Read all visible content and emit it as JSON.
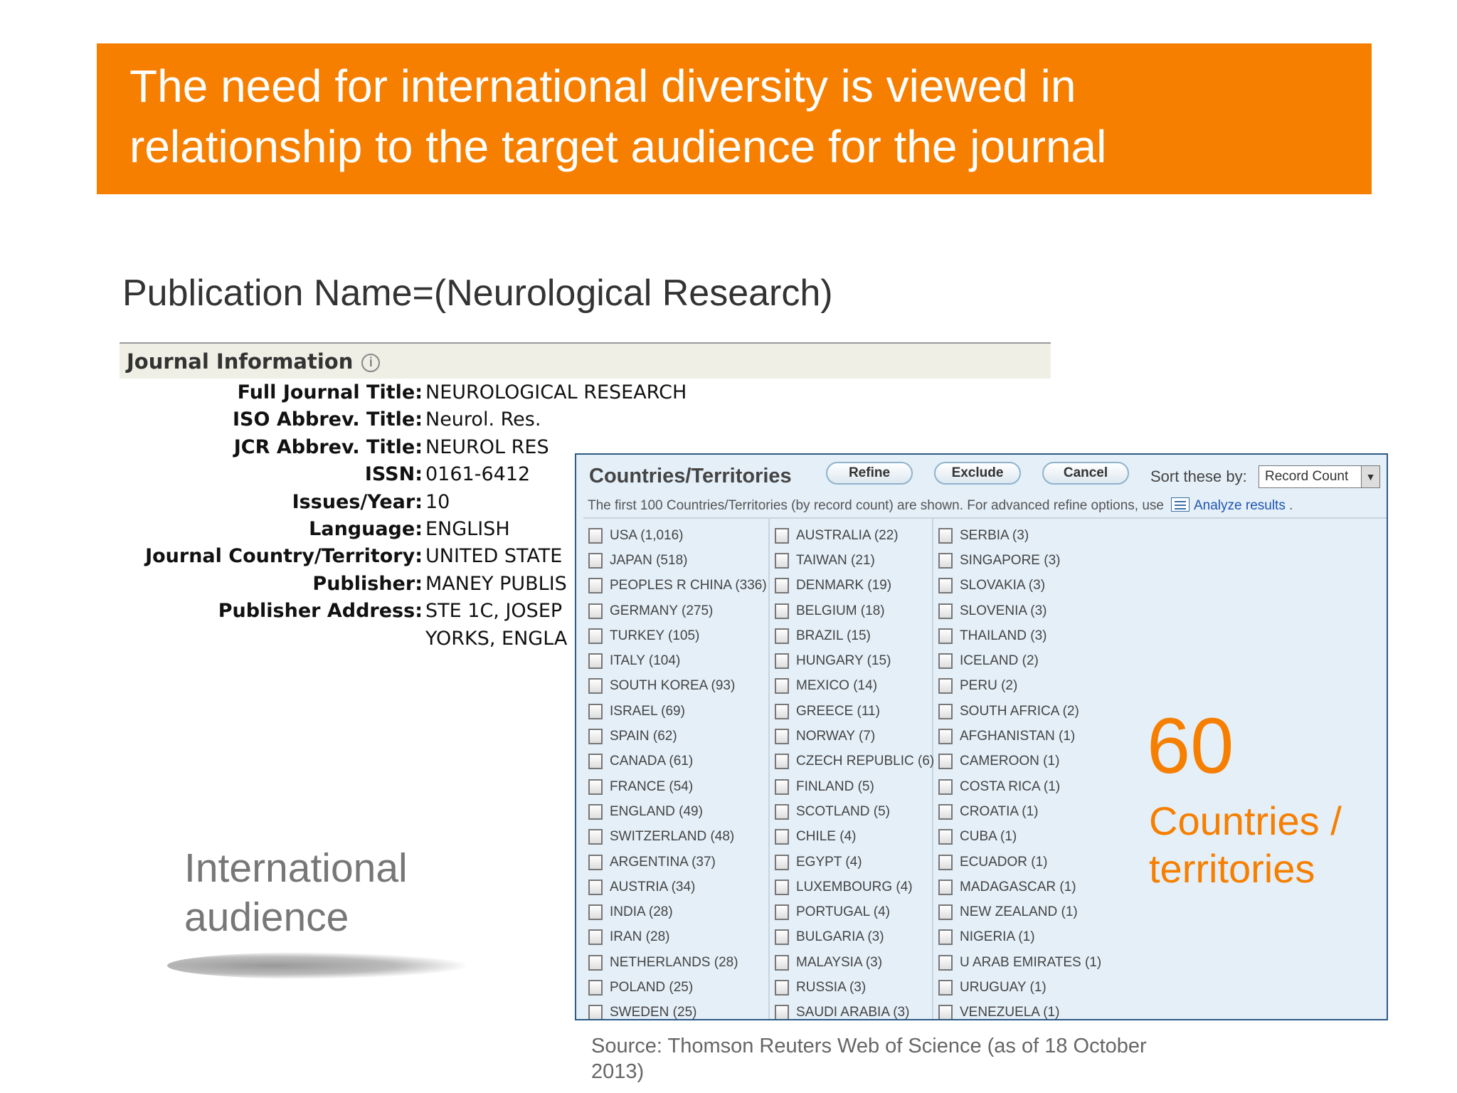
{
  "slide": {
    "title_lines": [
      "The need for international diversity is viewed in",
      "relationship to the target audience for the journal"
    ],
    "publication_query": "Publication Name=(Neurological Research)",
    "callout_number": "60",
    "callout_lines": [
      "Countries /",
      "territories"
    ],
    "side_lines": [
      "International",
      "audience"
    ],
    "source": "Source: Thomson Reuters  Web of Science (as of 18 October 2013)",
    "accent_color": "#f77f00"
  },
  "journal": {
    "header": "Journal Information",
    "info_icon": "i",
    "fields": [
      {
        "label": "Full Journal Title:",
        "value": "NEUROLOGICAL RESEARCH"
      },
      {
        "label": "ISO Abbrev. Title:",
        "value": "Neurol. Res."
      },
      {
        "label": "JCR Abbrev. Title:",
        "value": "NEUROL RES"
      },
      {
        "label": "ISSN:",
        "value": "0161-6412"
      },
      {
        "label": "Issues/Year:",
        "value": "10"
      },
      {
        "label": "Language:",
        "value": "ENGLISH"
      },
      {
        "label": "Journal Country/Territory:",
        "value": "UNITED STATE"
      },
      {
        "label": "Publisher:",
        "value": "MANEY PUBLIS"
      },
      {
        "label": "Publisher Address:",
        "value": "STE 1C, JOSEP"
      },
      {
        "label": "",
        "value": "YORKS, ENGLA"
      }
    ]
  },
  "panel": {
    "title": "Countries/Territories",
    "refine": "Refine",
    "exclude": "Exclude",
    "cancel": "Cancel",
    "sort_label": "Sort these by:",
    "sort_value": "Record Count",
    "info_text": "The first 100 Countries/Territories (by record count) are shown. For advanced refine options, use",
    "analyze_link": "Analyze results",
    "info_end": ".",
    "columns": [
      [
        "USA (1,016)",
        "JAPAN (518)",
        "PEOPLES R CHINA (336)",
        "GERMANY (275)",
        "TURKEY (105)",
        "ITALY (104)",
        "SOUTH KOREA (93)",
        "ISRAEL (69)",
        "SPAIN (62)",
        "CANADA (61)",
        "FRANCE (54)",
        "ENGLAND (49)",
        "SWITZERLAND (48)",
        "ARGENTINA (37)",
        "AUSTRIA (34)",
        "INDIA (28)",
        "IRAN (28)",
        "NETHERLANDS (28)",
        "POLAND (25)",
        "SWEDEN (25)"
      ],
      [
        "AUSTRALIA (22)",
        "TAIWAN (21)",
        "DENMARK (19)",
        "BELGIUM (18)",
        "BRAZIL (15)",
        "HUNGARY (15)",
        "MEXICO (14)",
        "GREECE (11)",
        "NORWAY (7)",
        "CZECH REPUBLIC (6)",
        "FINLAND (5)",
        "SCOTLAND (5)",
        "CHILE (4)",
        "EGYPT (4)",
        "LUXEMBOURG (4)",
        "PORTUGAL (4)",
        "BULGARIA (3)",
        "MALAYSIA (3)",
        "RUSSIA (3)",
        "SAUDI ARABIA (3)"
      ],
      [
        "SERBIA (3)",
        "SINGAPORE (3)",
        "SLOVAKIA (3)",
        "SLOVENIA (3)",
        "THAILAND (3)",
        "ICELAND (2)",
        "PERU (2)",
        "SOUTH AFRICA (2)",
        "AFGHANISTAN (1)",
        "CAMEROON (1)",
        "COSTA RICA (1)",
        "CROATIA (1)",
        "CUBA (1)",
        "ECUADOR (1)",
        "MADAGASCAR (1)",
        "NEW ZEALAND (1)",
        "NIGERIA (1)",
        "U ARAB EMIRATES (1)",
        "URUGUAY (1)",
        "VENEZUELA (1)"
      ]
    ]
  }
}
